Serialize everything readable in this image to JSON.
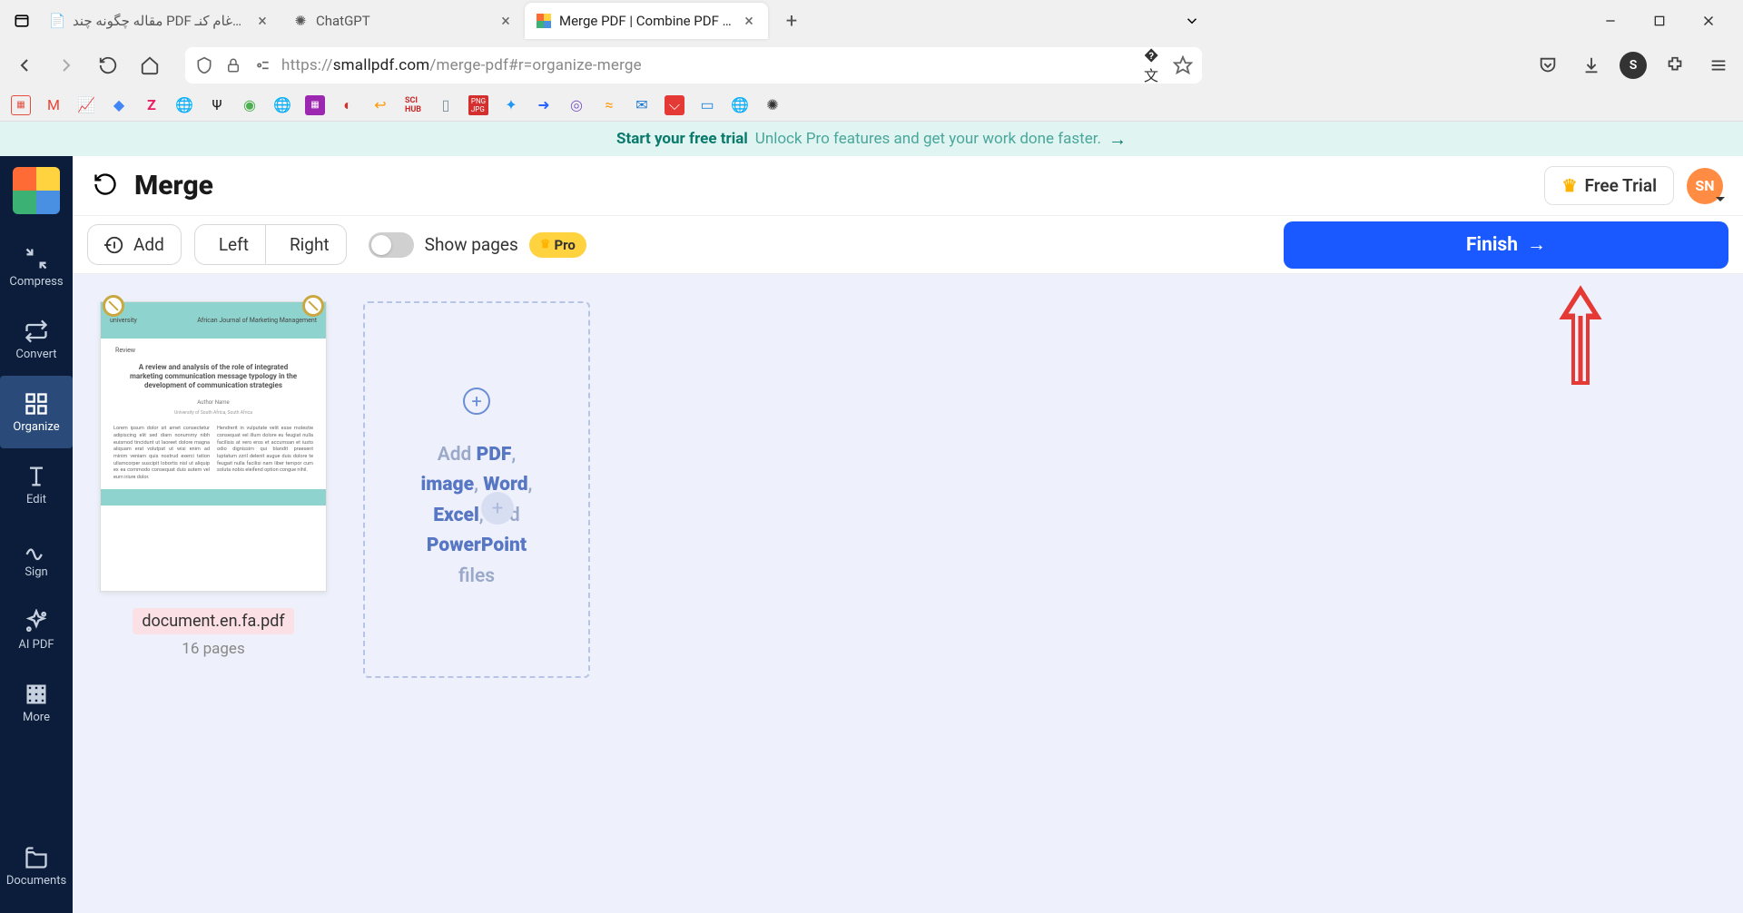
{
  "browser": {
    "tabs": [
      {
        "title": "مقاله چگونه چند PDF را باهم ادغام کنـ",
        "favicon": "doc"
      },
      {
        "title": "ChatGPT",
        "favicon": "chat"
      },
      {
        "title": "Merge PDF | Combine PDF Files",
        "favicon": "smallpdf",
        "active": true
      }
    ],
    "url_prefix": "https://",
    "url_domain": "smallpdf.com",
    "url_path": "/merge-pdf#r=organize-merge"
  },
  "banner": {
    "cta": "Start your free trial",
    "text": "Unlock Pro features and get your work done faster."
  },
  "header": {
    "title": "Merge",
    "free_trial": "Free Trial",
    "avatar": "SN"
  },
  "sidebar": {
    "items": [
      {
        "label": "Compress"
      },
      {
        "label": "Convert"
      },
      {
        "label": "Organize"
      },
      {
        "label": "Edit"
      },
      {
        "label": "Sign"
      },
      {
        "label": "AI PDF"
      },
      {
        "label": "More"
      }
    ],
    "documents": "Documents"
  },
  "toolbar": {
    "add": "Add",
    "left": "Left",
    "right": "Right",
    "show_pages": "Show pages",
    "pro": "Pro",
    "finish": "Finish"
  },
  "file": {
    "name": "document.en.fa.pdf",
    "pages": "16 pages"
  },
  "thumb": {
    "journal_left": "university",
    "journal_right": "African Journal of Marketing Management",
    "review": "Review",
    "doc_title_l1": "A review and analysis of the role of integrated",
    "doc_title_l2": "marketing communication message typology in the",
    "doc_title_l3": "development of communication strategies"
  },
  "dropzone": {
    "add": "Add",
    "pdf": "PDF",
    "image": "image",
    "word": "Word",
    "excel": "Excel",
    "and": ", and",
    "ppt": "PowerPoint",
    "files": "files"
  }
}
